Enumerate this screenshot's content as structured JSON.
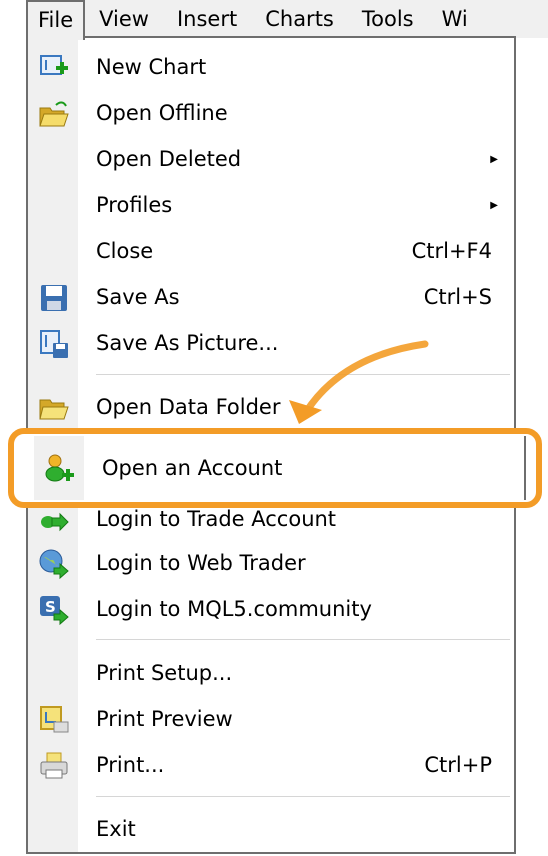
{
  "menubar": {
    "items": [
      "File",
      "View",
      "Insert",
      "Charts",
      "Tools",
      "Wi"
    ]
  },
  "menu": {
    "new_chart": "New Chart",
    "open_offline": "Open Offline",
    "open_deleted": "Open Deleted",
    "profiles": "Profiles",
    "close": "Close",
    "close_sc": "Ctrl+F4",
    "save_as": "Save As",
    "save_as_sc": "Ctrl+S",
    "save_as_picture": "Save As Picture...",
    "open_data_folder": "Open Data Folder",
    "open_account": "Open an Account",
    "login_trade": "Login to Trade Account",
    "login_web": "Login to Web Trader",
    "login_mql5": "Login to MQL5.community",
    "print_setup": "Print Setup...",
    "print_preview": "Print Preview",
    "print": "Print...",
    "print_sc": "Ctrl+P",
    "exit": "Exit"
  },
  "colors": {
    "highlight": "#f39c27"
  }
}
